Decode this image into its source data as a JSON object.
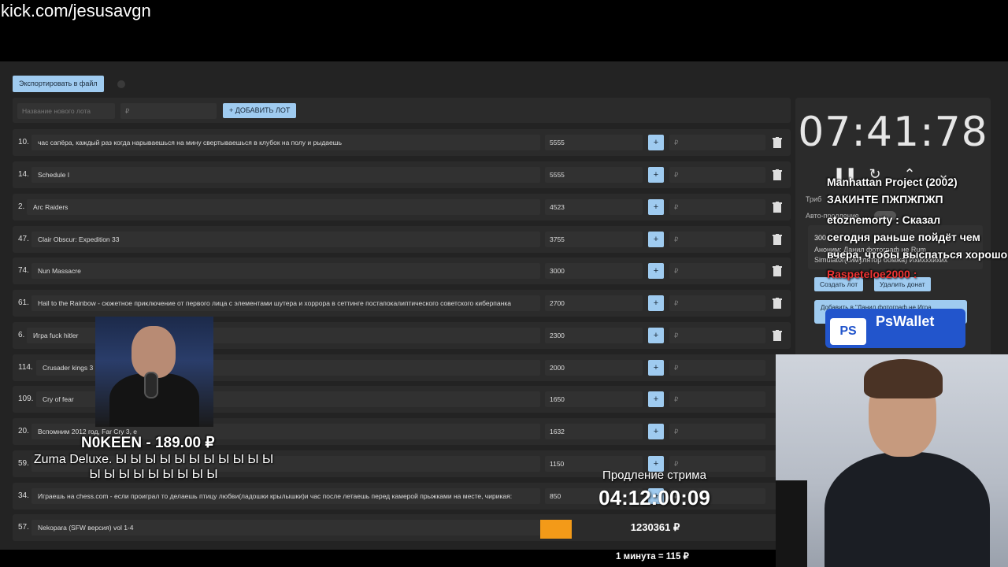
{
  "url": "kick.com/jesusavgn",
  "toolbar": {
    "export_label": "Экспортировать в файл"
  },
  "new_lot": {
    "name_placeholder": "Название нового лота",
    "amount_placeholder": "₽",
    "add_label": "+ ДОБАВИТЬ ЛОТ"
  },
  "lots": [
    {
      "num": "10.",
      "name": "час сапёра, каждый раз когда нарываешься на мину свертываешься в клубок на полу и рыдаешь",
      "amount": "5555"
    },
    {
      "num": "14.",
      "name": "Schedule I",
      "amount": "5555"
    },
    {
      "num": "2.",
      "name": "Arc Raiders",
      "amount": "4523"
    },
    {
      "num": "47.",
      "name": "Clair Obscur: Expedition 33",
      "amount": "3755"
    },
    {
      "num": "74.",
      "name": "Nun Massacre",
      "amount": "3000"
    },
    {
      "num": "61.",
      "name": "Hail to the Rainbow - сюжетное приключение от первого лица с элементами шутера и хоррора в сеттинге постапокалиптического советского киберпанка",
      "amount": "2700"
    },
    {
      "num": "6.",
      "name": "Игра fuck hitler",
      "amount": "2300"
    },
    {
      "num": "114.",
      "name": "Crusader kings 3",
      "amount": "2000"
    },
    {
      "num": "109.",
      "name": "Cry of fear",
      "amount": "1650"
    },
    {
      "num": "20.",
      "name": "Вспомним 2012 год, Far Cry 3, e",
      "amount": "1632"
    },
    {
      "num": "59.",
      "name": "",
      "amount": "1150"
    },
    {
      "num": "34.",
      "name": "Играешь на chess.com - если проиграл то делаешь птицу любви(ладошки крылышки)и час после летаешь перед камерой прыжками на месте, чирикая:",
      "amount": "850"
    },
    {
      "num": "57.",
      "name": "Nekopara (SFW версия) vol 1-4",
      "amount": ""
    }
  ],
  "rub_symbol": "₽",
  "plus_symbol": "+",
  "timer": {
    "value": "07:41:78"
  },
  "side_panel": {
    "tribute_label": "Триб",
    "auto_label": "Авто-продление",
    "line1": "300",
    "line2": "Аноним: Данил фотограф не Rum",
    "line3": "Simulator(симулятор бомжа) Ихихххихих",
    "create_lot": "Создать лот",
    "delete_donat": "Удалить донат",
    "wide_btn": "Добавить в \"Данил фотограф не Игра"
  },
  "chat": [
    {
      "text": "Manhattan Project (2002)"
    },
    {
      "text": "ЗАКИНТЕ ПЖПЖПЖП"
    },
    {
      "text": "etoznemorty : Сказал"
    },
    {
      "text": "сегодня раньше пойдёт чем"
    },
    {
      "text": "вчера, чтобы выспаться хорошо"
    },
    {
      "text": "Raspeteloe2000 :"
    }
  ],
  "pswallet": {
    "logo": "PS",
    "label": "PsWallet"
  },
  "donation": {
    "donor": "N0KEEN - 189.00 ₽",
    "message": "Zuma Deluxe. Ы Ы Ы Ы Ы Ы Ы Ы Ы Ы Ы Ы Ы Ы Ы Ы Ы Ы Ы Ы"
  },
  "prolong": {
    "label": "Продление стрима",
    "time": "04:12:00:09"
  },
  "total": "1230361 ₽",
  "rate": "1 минута = 115 ₽",
  "colors": {
    "accent": "#9fcbf0",
    "orange": "#f39a18",
    "bg": "#232323",
    "row": "#2b2b2b"
  }
}
